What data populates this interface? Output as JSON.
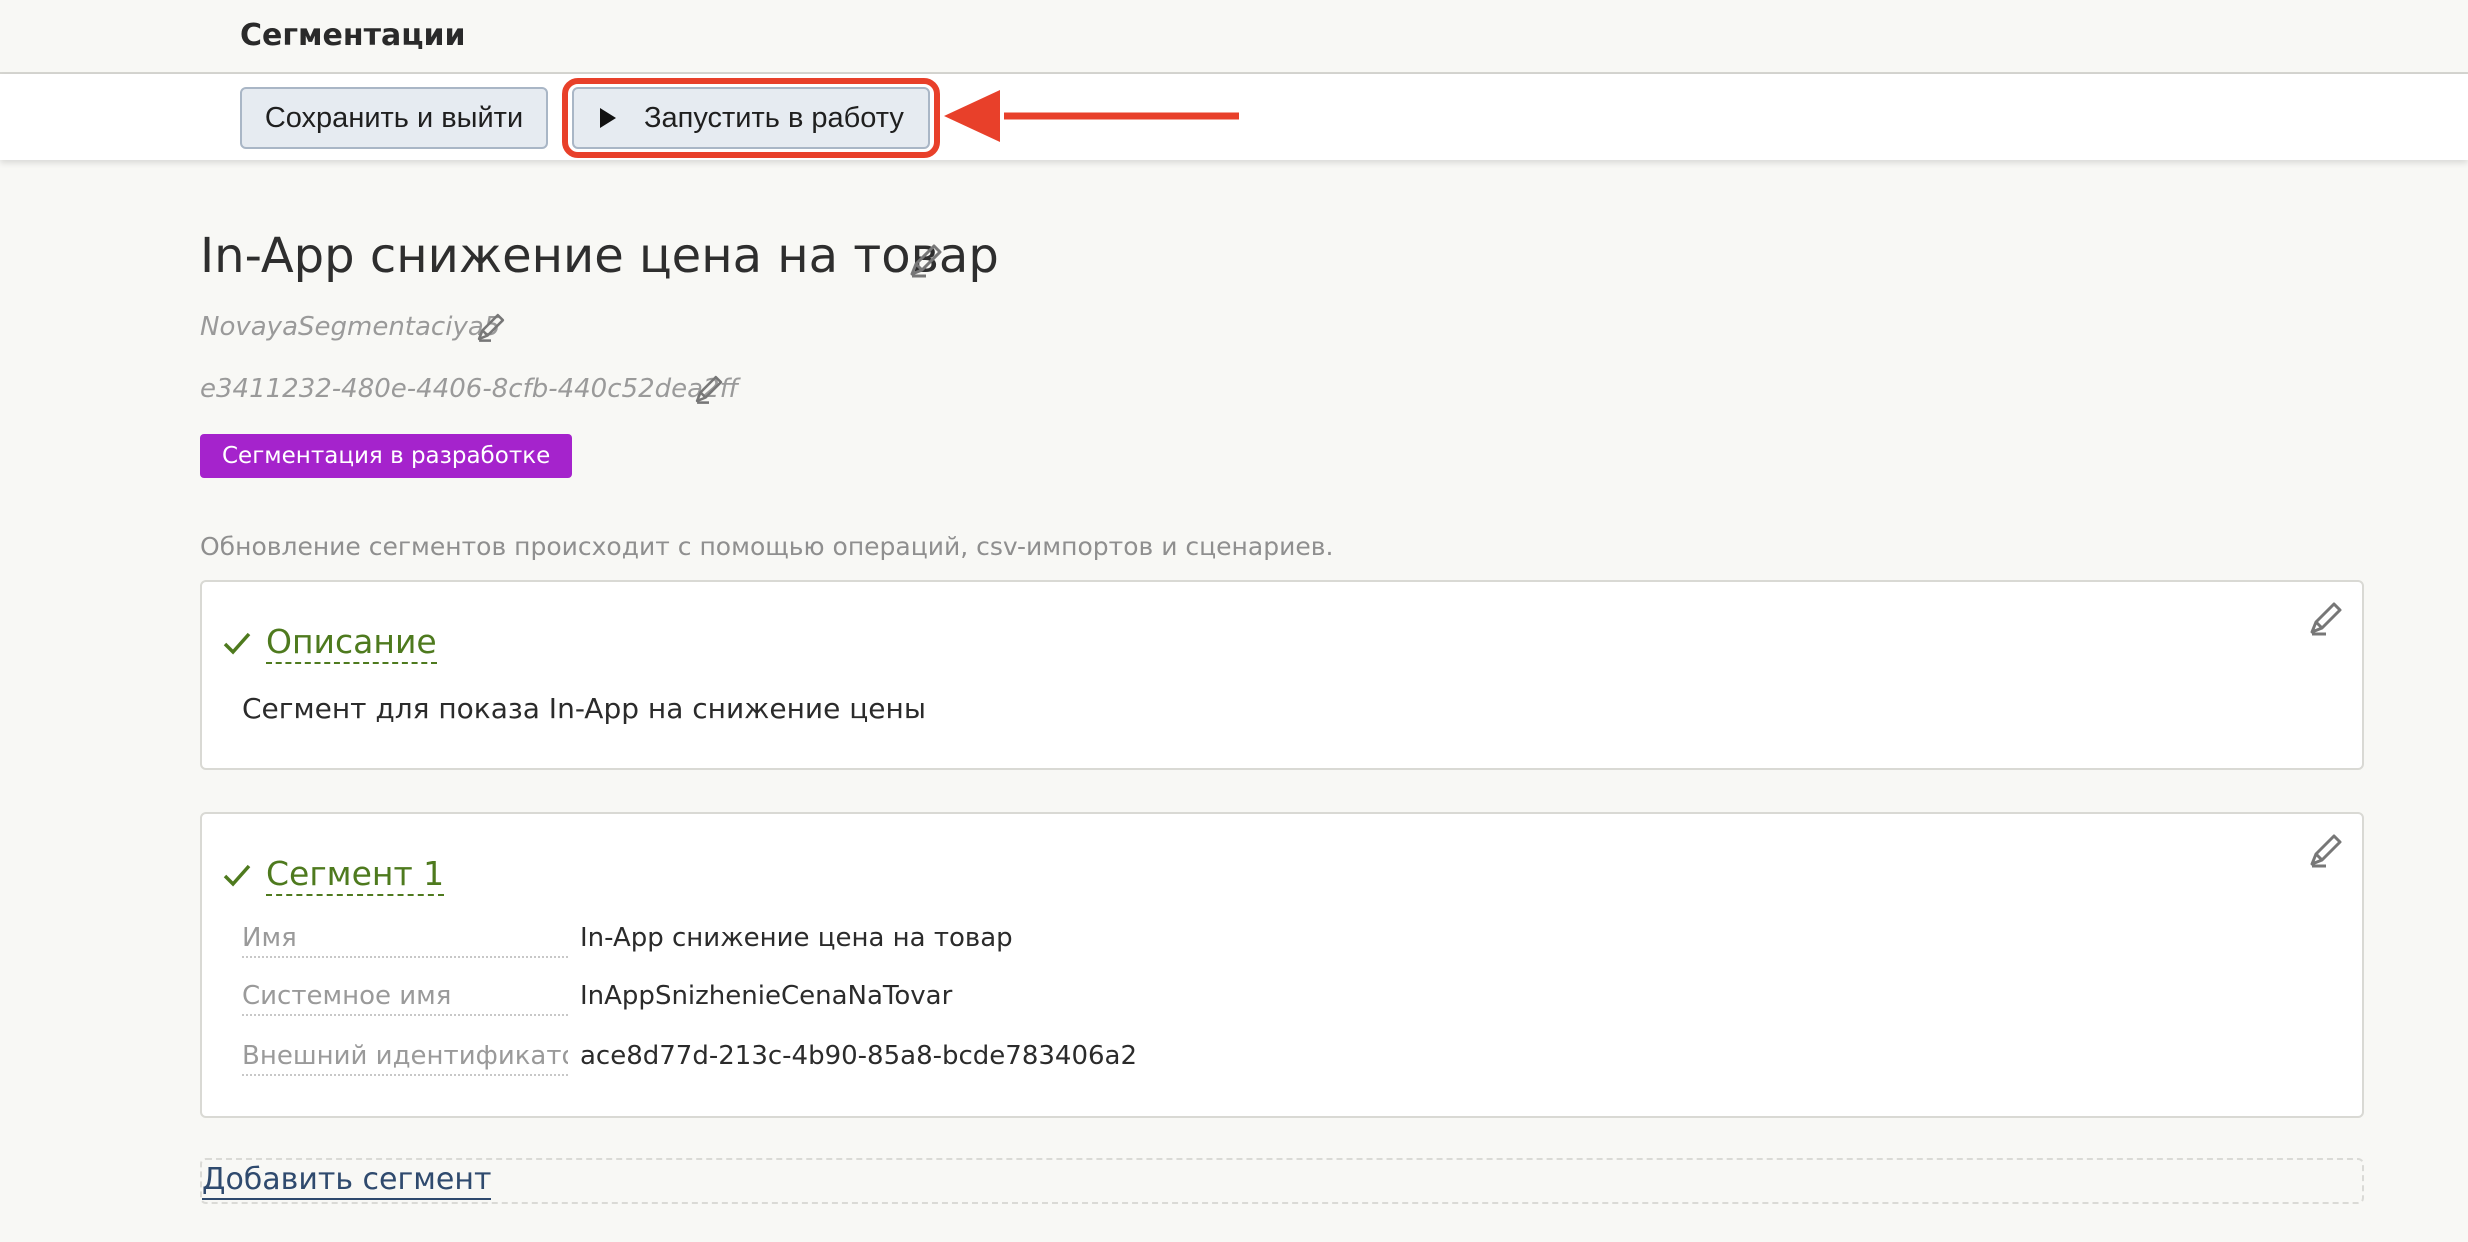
{
  "header": {
    "title": "Сегментации"
  },
  "toolbar": {
    "save_label": "Сохранить и выйти",
    "launch_label": "Запустить в работу",
    "highlight_color": "#e8402a"
  },
  "segmentation": {
    "title": "In-App снижение цена на товар",
    "system_name": "NovayaSegmentaciya5",
    "uuid": "e3411232-480e-4406-8cfb-440c52dea2ff",
    "status": "Сегментация в разработке",
    "status_color": "#a523cc",
    "note": "Обновление сегментов происходит с помощью операций, csv-импортов и сценариев."
  },
  "description_card": {
    "title": "Описание",
    "text": "Сегмент для показа In-App на снижение цены"
  },
  "segment_card": {
    "title": "Сегмент 1",
    "fields": [
      {
        "label": "Имя",
        "value": "In-App снижение цена на товар"
      },
      {
        "label": "Системное имя",
        "value": "InAppSnizhenieCenaNaTovar"
      },
      {
        "label": "Внешний идентификатор",
        "value": "ace8d77d-213c-4b90-85a8-bcde783406a2"
      }
    ]
  },
  "add_segment_label": "Добавить сегмент",
  "icons": {
    "edit": "pencil-icon",
    "check": "check-icon",
    "play": "play-icon",
    "arrow": "arrow-left-icon"
  }
}
